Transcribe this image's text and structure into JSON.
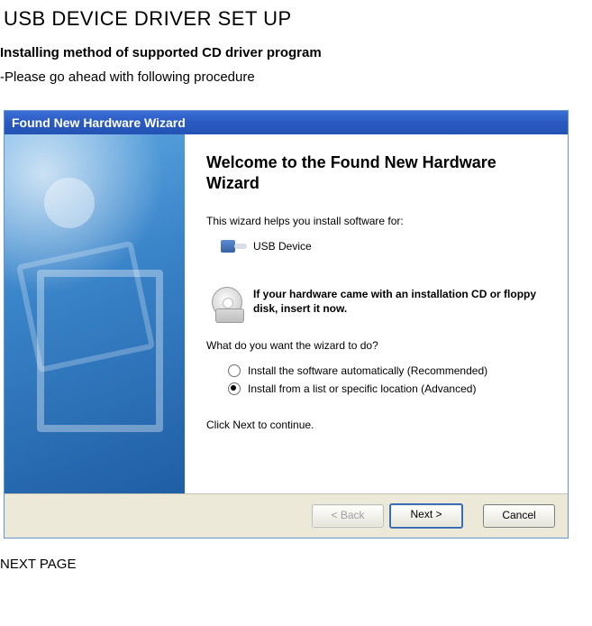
{
  "page_title": "USB DEVICE DRIVER SET UP",
  "subheading": "Installing method of supported CD driver program",
  "instruction": "-Please go ahead with following procedure",
  "next_page_label": "NEXT PAGE",
  "window": {
    "title": "Found New Hardware Wizard"
  },
  "wizard": {
    "heading": "Welcome to the Found New Hardware Wizard",
    "intro_text": "This wizard helps you install software for:",
    "device_name": "USB Device",
    "cd_hint": "If your hardware came with an installation CD or floppy disk, insert it now.",
    "question": "What do you want the wizard to do?",
    "options": [
      {
        "label": "Install the software automatically (Recommended)",
        "checked": false
      },
      {
        "label": "Install from a list or specific location (Advanced)",
        "checked": true
      }
    ],
    "click_next": "Click Next to continue."
  },
  "buttons": {
    "back": "< Back",
    "next": "Next >",
    "cancel": "Cancel"
  }
}
